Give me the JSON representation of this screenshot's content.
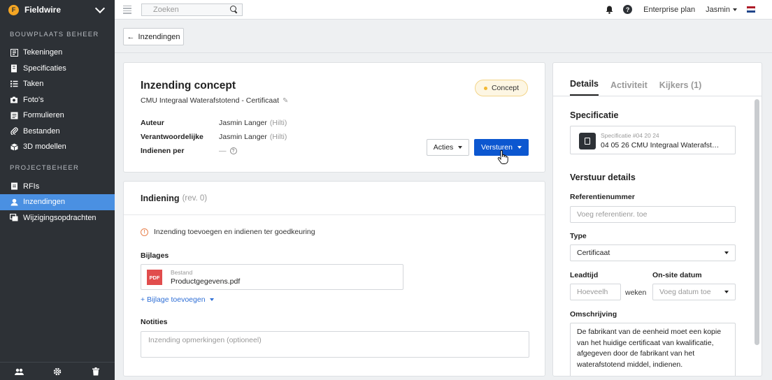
{
  "brand": {
    "name": "Fieldwire",
    "logo_text": "F"
  },
  "sidebar": {
    "section1_title": "BOUWPLAATS BEHEER",
    "section1_items": [
      {
        "label": "Tekeningen",
        "icon": "drawings-icon"
      },
      {
        "label": "Specificaties",
        "icon": "specifications-icon"
      },
      {
        "label": "Taken",
        "icon": "tasks-icon"
      },
      {
        "label": "Foto's",
        "icon": "camera-icon"
      },
      {
        "label": "Formulieren",
        "icon": "forms-icon"
      },
      {
        "label": "Bestanden",
        "icon": "paperclip-icon"
      },
      {
        "label": "3D modellen",
        "icon": "cube-icon"
      }
    ],
    "section2_title": "PROJECTBEHEER",
    "section2_items": [
      {
        "label": "RFIs",
        "icon": "rfi-icon"
      },
      {
        "label": "Inzendingen",
        "icon": "submittal-icon",
        "active": true
      },
      {
        "label": "Wijzigingsopdrachten",
        "icon": "change-order-icon"
      }
    ],
    "footer_icons": [
      "people-icon",
      "gear-icon",
      "trash-icon"
    ]
  },
  "topbar": {
    "search_placeholder": "Zoeken",
    "plan": "Enterprise plan",
    "user": "Jasmin",
    "help_glyph": "?"
  },
  "backbar": {
    "back_label": "Inzendingen"
  },
  "header": {
    "title": "Inzending concept",
    "subtitle": "CMU Integraal Waterafstotend - Certificaat",
    "status": "Concept",
    "author_label": "Auteur",
    "author_value": "Jasmin Langer",
    "author_company": "(Hilti)",
    "responsible_label": "Verantwoordelijke",
    "responsible_value": "Jasmin Langer",
    "responsible_company": "(Hilti)",
    "due_label": "Indienen per",
    "due_value": "—",
    "actions_label": "Acties",
    "send_label": "Versturen"
  },
  "indiening": {
    "title": "Indiening",
    "revision": "(rev. 0)",
    "info": "Inzending toevoegen en indienen ter goedkeuring",
    "attachments_label": "Bijlages",
    "file_type": "Bestand",
    "file_name": "Productgegevens.pdf",
    "pdf_badge": "PDF",
    "add_attachment": "+ Bijlage toevoegen",
    "notes_label": "Notities",
    "notes_placeholder": "Inzending opmerkingen (optioneel)"
  },
  "details": {
    "tabs": [
      "Details",
      "Activiteit",
      "Kijkers (1)"
    ],
    "spec_title": "Specificatie",
    "spec_code": "Specificatie #04 20 24",
    "spec_name": "04 05 26 CMU Integraal Waterafst…",
    "send_title": "Verstuur details",
    "ref_label": "Referentienummer",
    "ref_placeholder": "Voeg referentienr. toe",
    "type_label": "Type",
    "type_value": "Certificaat",
    "lead_label": "Leadtijd",
    "lead_placeholder": "Hoeveelh",
    "lead_unit": "weken",
    "onsite_label": "On-site datum",
    "onsite_placeholder": "Voeg datum toe",
    "desc_label": "Omschrijving",
    "desc_value": "De fabrikant van de eenheid moet een kopie van het huidige certificaat van kwalificatie, afgegeven door de fabrikant van het waterafstotend middel, indienen."
  },
  "colors": {
    "sidebar": "#2d3136",
    "active": "#4a90e2",
    "primary": "#0c57d0",
    "badge": "#f2b833",
    "pdf": "#e14d4d"
  }
}
